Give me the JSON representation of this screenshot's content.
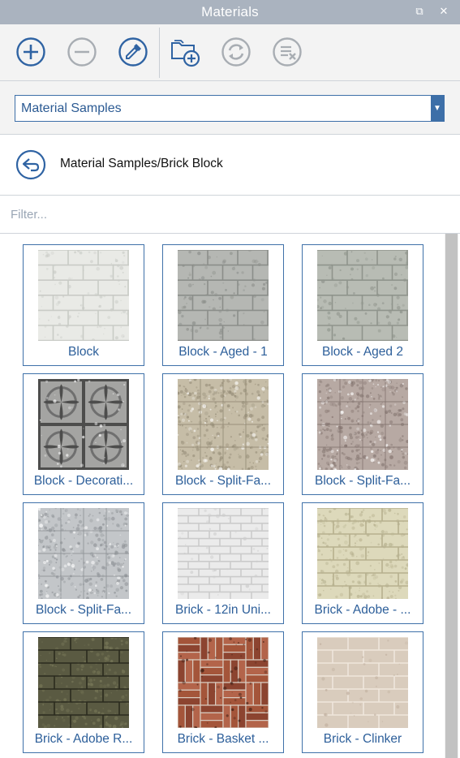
{
  "window": {
    "title": "Materials",
    "restore_glyph": "⧉",
    "close_glyph": "✕"
  },
  "toolbar": {
    "buttons": [
      {
        "name": "create-material",
        "icon": "plus-circle-icon"
      },
      {
        "name": "remove-material",
        "icon": "minus-circle-icon"
      },
      {
        "name": "sample-paint",
        "icon": "eyedropper-icon"
      },
      {
        "name": "add-collection",
        "icon": "folder-plus-icon"
      },
      {
        "name": "refresh",
        "icon": "refresh-icon"
      },
      {
        "name": "purge-unused",
        "icon": "purge-icon"
      }
    ]
  },
  "collection": {
    "selected": "Material Samples"
  },
  "breadcrumb": {
    "path": "Material Samples/Brick Block"
  },
  "filter": {
    "value": "",
    "placeholder": "Filter..."
  },
  "materials": [
    {
      "label": "Block",
      "texture": "block-white",
      "colors": [
        "#e9eae6",
        "#c9cbc6"
      ]
    },
    {
      "label": "Block - Aged - 1",
      "texture": "block-grey",
      "colors": [
        "#b5b7b3",
        "#8b8e8a"
      ]
    },
    {
      "label": "Block - Aged 2",
      "texture": "block-grey",
      "colors": [
        "#b8bcb4",
        "#8f948c"
      ]
    },
    {
      "label": "Block - Decorati...",
      "texture": "decorative-block",
      "colors": [
        "#a4a4a2",
        "#4d4d4c"
      ]
    },
    {
      "label": "Block - Split-Fa...",
      "texture": "split-face",
      "colors": [
        "#c6bda7",
        "#948b76"
      ]
    },
    {
      "label": "Block - Split-Fa...",
      "texture": "split-face",
      "colors": [
        "#b7a9a3",
        "#847570"
      ]
    },
    {
      "label": "Block - Split-Fa...",
      "texture": "split-face",
      "colors": [
        "#c3c6c9",
        "#8e9296"
      ]
    },
    {
      "label": "Brick - 12in Uni...",
      "texture": "brick-thin",
      "colors": [
        "#ebebeb",
        "#cbcbcb"
      ]
    },
    {
      "label": "Brick - Adobe - ...",
      "texture": "adobe",
      "colors": [
        "#ddd9bb",
        "#b6b08e"
      ]
    },
    {
      "label": "Brick - Adobe R...",
      "texture": "adobe-dark",
      "colors": [
        "#5a5a42",
        "#3a3a2a"
      ]
    },
    {
      "label": "Brick - Basket ...",
      "texture": "basket",
      "colors": [
        "#9b4e36",
        "#6f3224"
      ]
    },
    {
      "label": "Brick - Clinker",
      "texture": "brick-clinker",
      "colors": [
        "#d9ccbd",
        "#bfae9d"
      ]
    }
  ]
}
